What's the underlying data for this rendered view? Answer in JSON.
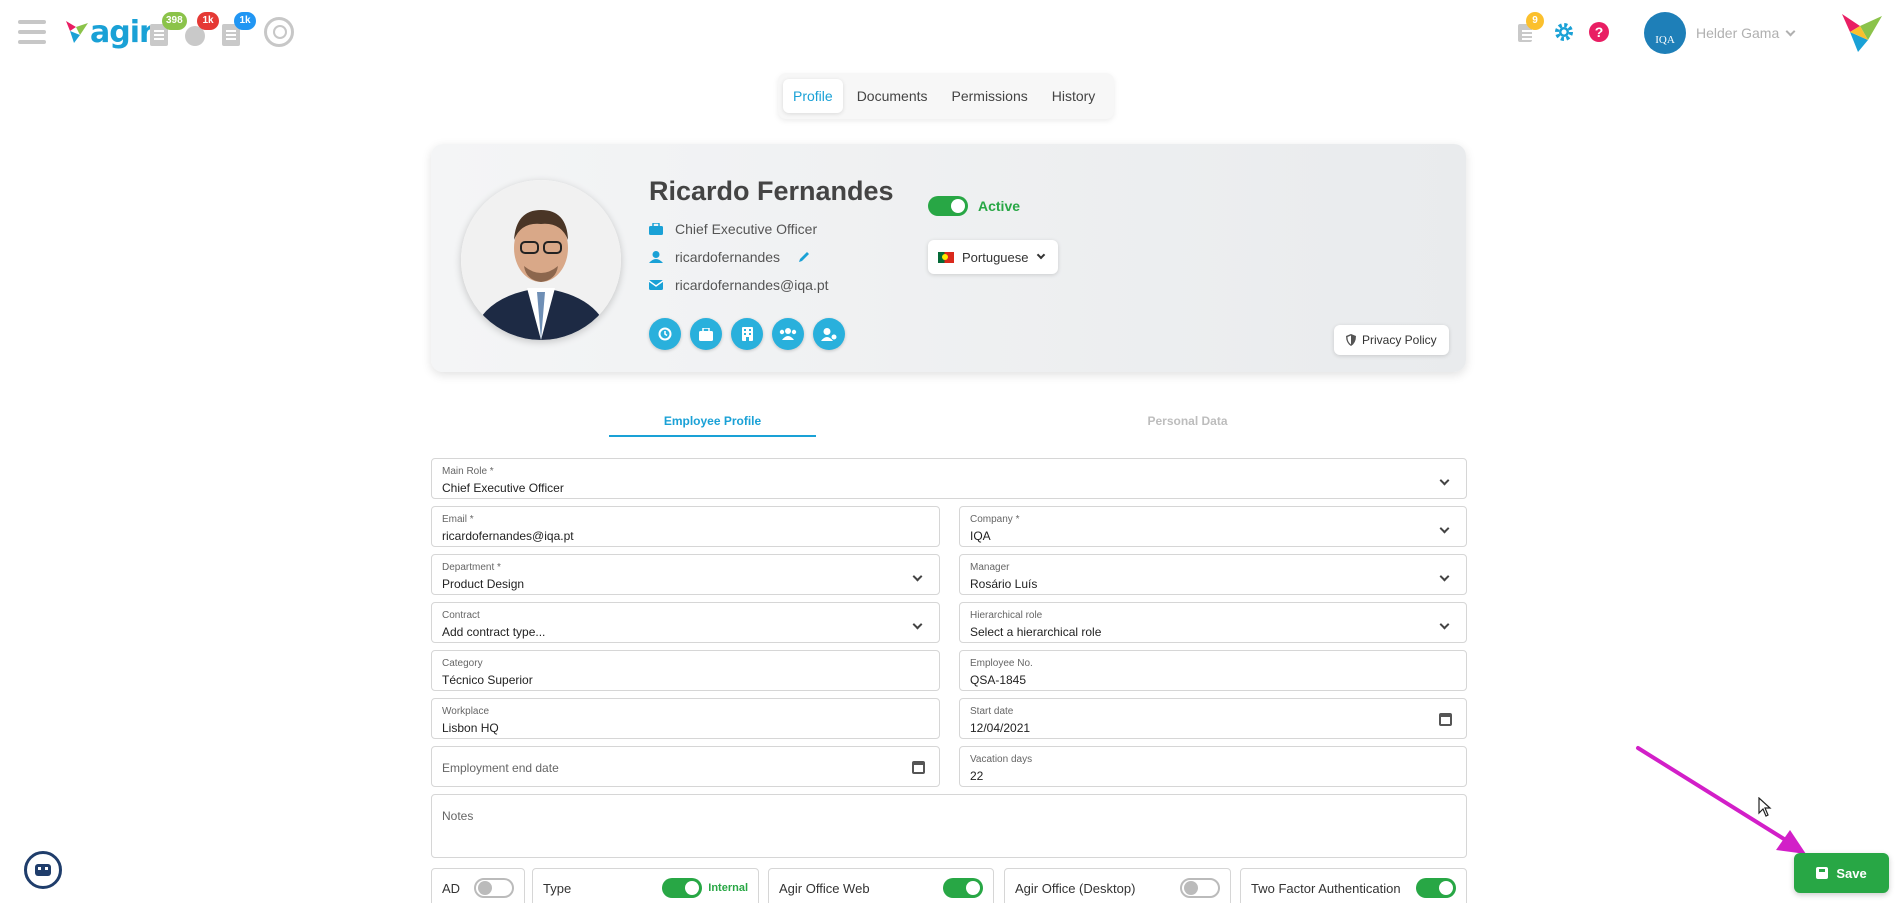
{
  "topbar": {
    "logo_text": "agir",
    "badges": [
      "398",
      "1k",
      "1k"
    ],
    "notifications_badge": "9",
    "user_name": "Helder Gama",
    "avatar_text": "IQA",
    "icons": [
      "menu-icon",
      "notes-icon",
      "reports-icon",
      "documents-icon",
      "search-icon",
      "notifications-icon",
      "settings-icon",
      "help-icon"
    ],
    "colors": {
      "badge_green": "#8bc34a",
      "badge_red": "#e53935",
      "badge_blue": "#2196f3",
      "badge_yellow": "#fbc02d",
      "gear": "#1aa1d6",
      "help": "#e91e63"
    }
  },
  "tabs": [
    "Profile",
    "Documents",
    "Permissions",
    "History"
  ],
  "profile": {
    "name": "Ricardo Fernandes",
    "job_title": "Chief Executive Officer",
    "username": "ricardofernandes",
    "email": "ricardofernandes@iqa.pt",
    "status": "Active",
    "language": "Portuguese",
    "privacy_label": "Privacy Policy",
    "action_icons": [
      "history-icon",
      "briefcase-icon",
      "building-icon",
      "team-icon",
      "user-settings-icon"
    ]
  },
  "subtabs": {
    "employee": "Employee Profile",
    "personal": "Personal Data"
  },
  "form": {
    "main_role": {
      "label": "Main Role *",
      "value": "Chief Executive Officer"
    },
    "email": {
      "label": "Email *",
      "value": "ricardofernandes@iqa.pt"
    },
    "company": {
      "label": "Company *",
      "value": "IQA"
    },
    "department": {
      "label": "Department *",
      "value": "Product Design"
    },
    "manager": {
      "label": "Manager",
      "value": "Rosário Luís"
    },
    "contract": {
      "label": "Contract",
      "value": "Add contract type..."
    },
    "hierarchical_role": {
      "label": "Hierarchical role",
      "value": "Select a hierarchical role"
    },
    "category": {
      "label": "Category",
      "value": "Técnico Superior"
    },
    "employee_no": {
      "label": "Employee No.",
      "value": "QSA-1845"
    },
    "workplace": {
      "label": "Workplace",
      "value": "Lisbon HQ"
    },
    "start_date": {
      "label": "Start date",
      "value": "12/04/2021"
    },
    "end_date": {
      "placeholder": "Employment end date"
    },
    "vacation_days": {
      "label": "Vacation days",
      "value": "22"
    },
    "notes": {
      "placeholder": "Notes"
    }
  },
  "toggles": {
    "ad": {
      "label": "AD",
      "on": false
    },
    "type": {
      "label": "Type",
      "on": true,
      "state_text": "Internal"
    },
    "office_web": {
      "label": "Agir Office Web",
      "on": true
    },
    "office_desktop": {
      "label": "Agir Office (Desktop)",
      "on": false
    },
    "two_factor": {
      "label": "Two Factor Authentication",
      "on": true
    }
  },
  "save_label": "Save"
}
